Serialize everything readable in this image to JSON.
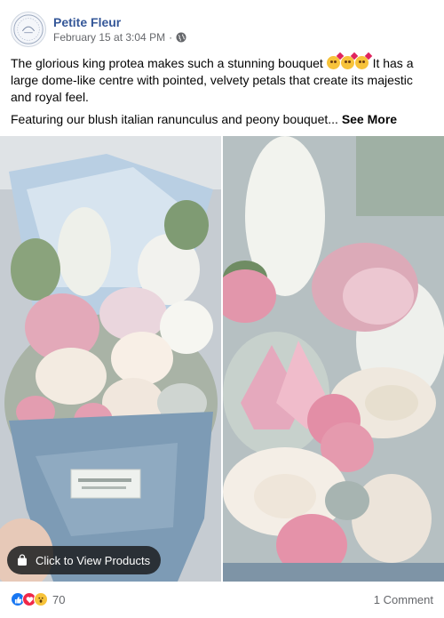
{
  "post": {
    "page_name": "Petite Fleur",
    "date": "February 15 at 3:04 PM",
    "separator": "·",
    "audience_icon": "globe-icon",
    "text_line1": "The glorious king protea makes such a stunning bouquet",
    "text_line1_after": "It has a large dome-like centre with pointed, velvety petals that create its majestic and royal feel.",
    "text_line2": "Featuring our blush italian ranunculus and peony bouquet...",
    "see_more": "See More",
    "emoji_icon": "smiling-face-with-hearts-emoji"
  },
  "media": {
    "cta_label": "Click to View Products",
    "cta_icon": "shopping-bag-icon"
  },
  "footer": {
    "reaction_icons": [
      "like-icon",
      "love-icon",
      "wow-icon"
    ],
    "reaction_count": "70",
    "comments": "1 Comment"
  },
  "colors": {
    "page_name": "#365899",
    "secondary_text": "#65676b",
    "like": "#1877f2",
    "love": "#f02849",
    "wow": "#f7c33a"
  }
}
